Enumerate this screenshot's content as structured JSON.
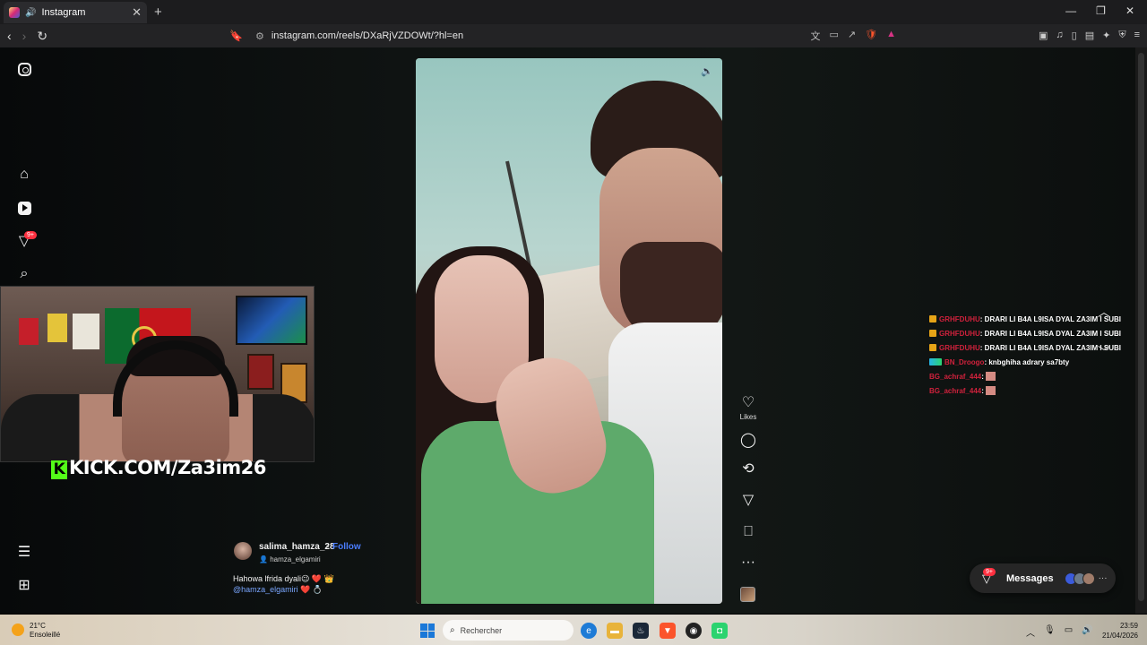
{
  "browser": {
    "tab_title": "Instagram",
    "tab_close": "✕",
    "new_tab": "+",
    "url": "instagram.com/reels/DXaRjVZDOWt/?hl=en",
    "window_controls": [
      "—",
      "❐",
      "✕"
    ]
  },
  "reel": {
    "username": "salima_hamza_28",
    "separator": "•",
    "follow_label": "Follow",
    "tagged_user": "hamza_elgamiri",
    "caption_line1": "Hahowa lfrida dyali😉 ❤️ 👑",
    "caption_mention": "@hamza_elgamiri",
    "caption_mention_suffix": " ❤️ 💍",
    "likes_label": "Likes"
  },
  "sidebar": {
    "notifications_badge": "9+"
  },
  "stream": {
    "kick_text": "KICK.COM/Za3im26",
    "kick_letter": "K"
  },
  "chat": [
    {
      "user": "GRHFDUHU",
      "message": ": DRARI LI B4A L9ISA DYAL ZA3IM I SUBI",
      "badge": "gold"
    },
    {
      "user": "GRHFDUHU",
      "message": ": DRARI LI B4A L9ISA DYAL ZA3IM I SUBI",
      "badge": "gold"
    },
    {
      "user": "GRHFDUHU",
      "message": ": DRARI LI B4A L9ISA DYAL ZA3IM I SUBI",
      "badge": "gold"
    },
    {
      "user": "BN_Droogo",
      "message": ": knbghiha adrary sa7bty",
      "badge": "blue"
    },
    {
      "user": "BG_achraf_444",
      "message": ": ",
      "badge": "none"
    },
    {
      "user": "BG_achraf_444",
      "message": ": ",
      "badge": "none"
    }
  ],
  "messages": {
    "label": "Messages",
    "badge": "9+",
    "more": "···"
  },
  "taskbar": {
    "temperature": "21°C",
    "weather": "Ensoleillé",
    "search_placeholder": "Rechercher",
    "time": "23:59",
    "date": "21/04/2026"
  },
  "colors": {
    "follow": "#4a7dff",
    "chat_user": "#d0213c",
    "kick_green": "#53fc18",
    "badge_red": "#ff3040"
  }
}
